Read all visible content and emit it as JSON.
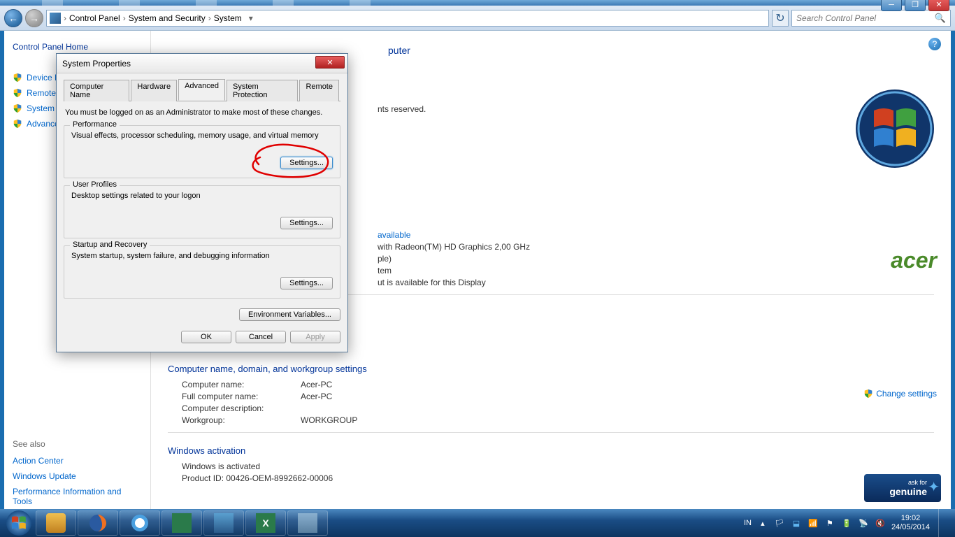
{
  "window": {
    "minimize": "─",
    "maximize": "❐",
    "close": "✕"
  },
  "nav": {
    "back": "←",
    "forward": "→",
    "refresh": "↻"
  },
  "breadcrumb": {
    "items": [
      "Control Panel",
      "System and Security",
      "System"
    ],
    "sep": "›"
  },
  "search": {
    "placeholder": "Search Control Panel",
    "icon": "🔍"
  },
  "sidebar": {
    "home": "Control Panel Home",
    "links": [
      "Device Manager",
      "Remote settings",
      "System protection",
      "Advanced system settings"
    ],
    "see_also_title": "See also",
    "see_also": [
      "Action Center",
      "Windows Update",
      "Performance Information and Tools"
    ]
  },
  "main": {
    "heading_suffix": "puter",
    "rights": "nts reserved.",
    "rating_link": "available",
    "processor_v": "with Radeon(TM) HD Graphics     2,00 GHz",
    "ram_suffix": "ple)",
    "systype_suffix": "tem",
    "pen_touch": "ut is available for this Display",
    "section_computer": "Computer name, domain, and workgroup settings",
    "computer_name_k": "Computer name:",
    "computer_name_v": "Acer-PC",
    "full_name_k": "Full computer name:",
    "full_name_v": "Acer-PC",
    "desc_k": "Computer description:",
    "desc_v": "",
    "workgroup_k": "Workgroup:",
    "workgroup_v": "WORKGROUP",
    "section_activation": "Windows activation",
    "activated": "Windows is activated",
    "product_id": "Product ID: 00426-OEM-8992662-00006",
    "change_settings": "Change settings",
    "acer": "acer",
    "genuine_ask": "ask for",
    "genuine": "genuine"
  },
  "dialog": {
    "title": "System Properties",
    "close": "✕",
    "tabs": [
      "Computer Name",
      "Hardware",
      "Advanced",
      "System Protection",
      "Remote"
    ],
    "active_tab": 2,
    "admin_note": "You must be logged on as an Administrator to make most of these changes.",
    "groups": [
      {
        "title": "Performance",
        "desc": "Visual effects, processor scheduling, memory usage, and virtual memory",
        "btn": "Settings..."
      },
      {
        "title": "User Profiles",
        "desc": "Desktop settings related to your logon",
        "btn": "Settings..."
      },
      {
        "title": "Startup and Recovery",
        "desc": "System startup, system failure, and debugging information",
        "btn": "Settings..."
      }
    ],
    "env_btn": "Environment Variables...",
    "ok": "OK",
    "cancel": "Cancel",
    "apply": "Apply"
  },
  "taskbar": {
    "lang": "IN",
    "time": "19:02",
    "date": "24/05/2014"
  }
}
